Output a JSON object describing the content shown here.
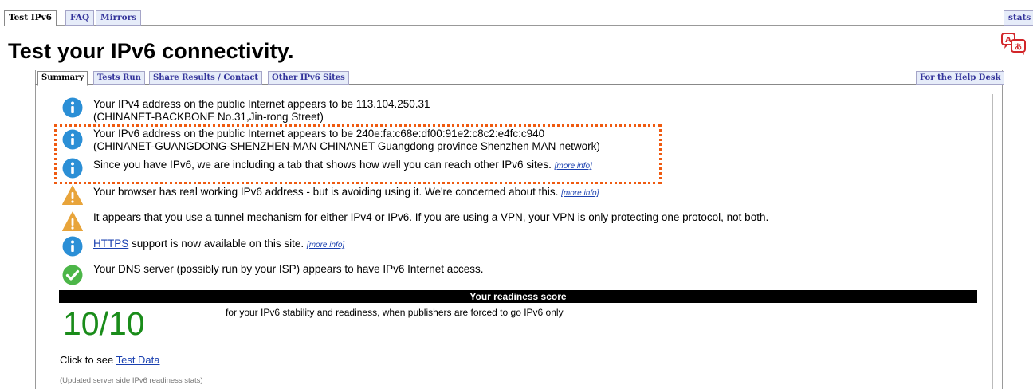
{
  "top_tabs": {
    "test_ipv6": "Test IPv6",
    "faq": "FAQ",
    "mirrors": "Mirrors",
    "stats": "stats"
  },
  "page_title": "Test your IPv6 connectivity.",
  "sub_tabs": {
    "summary": "Summary",
    "tests_run": "Tests Run",
    "share_results": "Share Results / Contact",
    "other_sites": "Other IPv6 Sites",
    "help_desk": "For the Help Desk"
  },
  "messages": {
    "ipv4_line1": "Your IPv4 address on the public Internet appears to be 113.104.250.31",
    "ipv4_line2": "(CHINANET-BACKBONE No.31,Jin-rong Street)",
    "ipv6_line1": "Your IPv6 address on the public Internet appears to be 240e:fa:c68e:df00:91e2:c8c2:e4fc:c940",
    "ipv6_line2": "(CHINANET-GUANGDONG-SHENZHEN-MAN CHINANET Guangdong province Shenzhen MAN network)",
    "ipv6_tab": "Since you have IPv6, we are including a tab that shows how well you can reach other IPv6 sites.",
    "avoiding": "Your browser has real working IPv6 address - but is avoiding using it. We're concerned about this.",
    "tunnel": "It appears that you use a tunnel mechanism for either IPv4 or IPv6. If you are using a VPN, your VPN is only protecting one protocol, not both.",
    "https_link": "HTTPS",
    "https_rest": "support is now available on this site.",
    "dns": "Your DNS server (possibly run by your ISP) appears to have IPv6 Internet access.",
    "more_info": "[more info]"
  },
  "readiness": {
    "header": "Your readiness score",
    "score": "10/10",
    "description": "for your IPv6 stability and readiness, when publishers are forced to go IPv6 only"
  },
  "footer": {
    "click_to_see": "Click to see",
    "test_data_link": "Test Data",
    "updated": "(Updated server side IPv6 readiness stats)"
  },
  "icons": {
    "info": "info-icon",
    "warning": "warning-icon",
    "check": "check-icon",
    "translate": "translate-icon"
  },
  "colors": {
    "info_blue": "#2b8fd6",
    "warning_orange": "#e8a43a",
    "check_green": "#4cb648",
    "score_green": "#1a8c1a",
    "highlight_orange": "#ef5a10",
    "tab_text": "#33339a"
  }
}
